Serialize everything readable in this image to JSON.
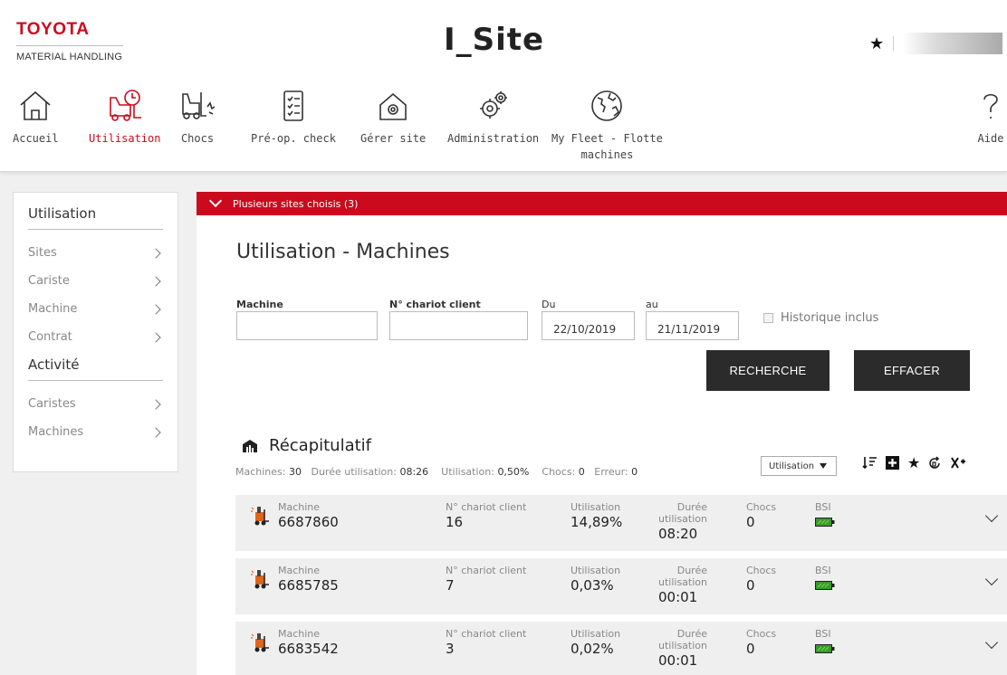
{
  "header": {
    "brand": "TOYOTA",
    "brand_sub": "MATERIAL HANDLING",
    "app_title": "I_Site",
    "brand_color": "#cc0a1e"
  },
  "nav": [
    {
      "label": "Accueil",
      "icon": "home-icon",
      "active": false
    },
    {
      "label": "Utilisation",
      "icon": "forklift-clock-icon",
      "active": true
    },
    {
      "label": "Chocs",
      "icon": "forklift-impact-icon",
      "active": false
    },
    {
      "label": "Pré-op. check",
      "icon": "checklist-icon",
      "active": false
    },
    {
      "label": "Gérer site",
      "icon": "site-gear-icon",
      "active": false
    },
    {
      "label": "Administration",
      "icon": "gears-icon",
      "active": false
    },
    {
      "label": "My Fleet - Flotte",
      "label2": "machines",
      "icon": "globe-icon",
      "active": false
    },
    {
      "label": "Aide",
      "icon": "question-icon",
      "active": false
    }
  ],
  "sidebar": {
    "section1": "Utilisation",
    "items1": [
      "Sites",
      "Cariste",
      "Machine",
      "Contrat"
    ],
    "section2": "Activité",
    "items2": [
      "Caristes",
      "Machines"
    ]
  },
  "banner": "Plusieurs sites choisis (3)",
  "page_title": "Utilisation - Machines",
  "filters": {
    "machine_label": "Machine",
    "chariot_label": "N° chariot client",
    "du_label": "Du",
    "au_label": "au",
    "du_value": "22/10/2019",
    "au_value": "21/11/2019",
    "historique_label": "Historique inclus",
    "historique_checked": false
  },
  "buttons": {
    "search": "RECHERCHE",
    "clear": "EFFACER"
  },
  "recap": {
    "title": "Récapitulatif",
    "machines_label": "Machines:",
    "machines_value": "30",
    "duree_label": "Durée utilisation:",
    "duree_value": "08:26",
    "util_label": "Utilisation:",
    "util_value": "0,50%",
    "chocs_label": "Chocs:",
    "chocs_value": "0",
    "erreur_label": "Erreur:",
    "erreur_value": "0",
    "dropdown": "Utilisation"
  },
  "columns": {
    "machine": "Machine",
    "chariot": "N° chariot client",
    "utilisation": "Utilisation",
    "duree1": "Durée",
    "duree2": "utilisation",
    "chocs": "Chocs",
    "bsi": "BSI"
  },
  "rows": [
    {
      "machine": "6687860",
      "chariot": "16",
      "utilisation": "14,89%",
      "duree": "08:20",
      "chocs": "0"
    },
    {
      "machine": "6685785",
      "chariot": "7",
      "utilisation": "0,03%",
      "duree": "00:01",
      "chocs": "0"
    },
    {
      "machine": "6683542",
      "chariot": "3",
      "utilisation": "0,02%",
      "duree": "00:01",
      "chocs": "0"
    }
  ]
}
